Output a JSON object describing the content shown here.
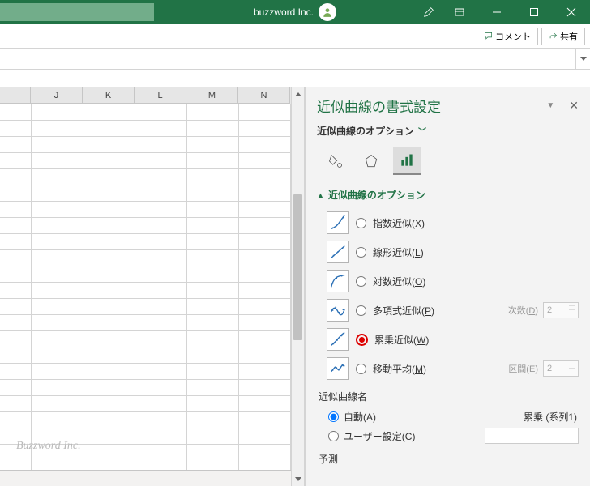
{
  "titlebar": {
    "title": "buzzword Inc."
  },
  "ribbon": {
    "comment": "コメント",
    "share": "共有"
  },
  "columns": [
    "J",
    "K",
    "L",
    "M",
    "N"
  ],
  "watermark": "Buzzword Inc.",
  "pane": {
    "title": "近似曲線の書式設定",
    "subtitle": "近似曲線のオプション",
    "section": "近似曲線のオプション",
    "options": {
      "exp": {
        "label": "指数近似(",
        "key": "X",
        "suffix": ")"
      },
      "lin": {
        "label": "線形近似(",
        "key": "L",
        "suffix": ")"
      },
      "log": {
        "label": "対数近似(",
        "key": "O",
        "suffix": ")"
      },
      "poly": {
        "label": "多項式近似(",
        "key": "P",
        "suffix": ")",
        "param_label": "次数(",
        "param_key": "D",
        "param_suffix": ")",
        "param_value": "2"
      },
      "pow": {
        "label": "累乗近似(",
        "key": "W",
        "suffix": ")"
      },
      "mavg": {
        "label": "移動平均(",
        "key": "M",
        "suffix": ")",
        "param_label": "区間(",
        "param_key": "E",
        "param_suffix": ")",
        "param_value": "2"
      }
    },
    "name_section": "近似曲線名",
    "name_auto": {
      "label": "自動(",
      "key": "A",
      "suffix": ")",
      "value": "累乗 (系列1)"
    },
    "name_custom": {
      "label": "ユーザー設定(",
      "key": "C",
      "suffix": ")"
    },
    "forecast": "予測"
  }
}
